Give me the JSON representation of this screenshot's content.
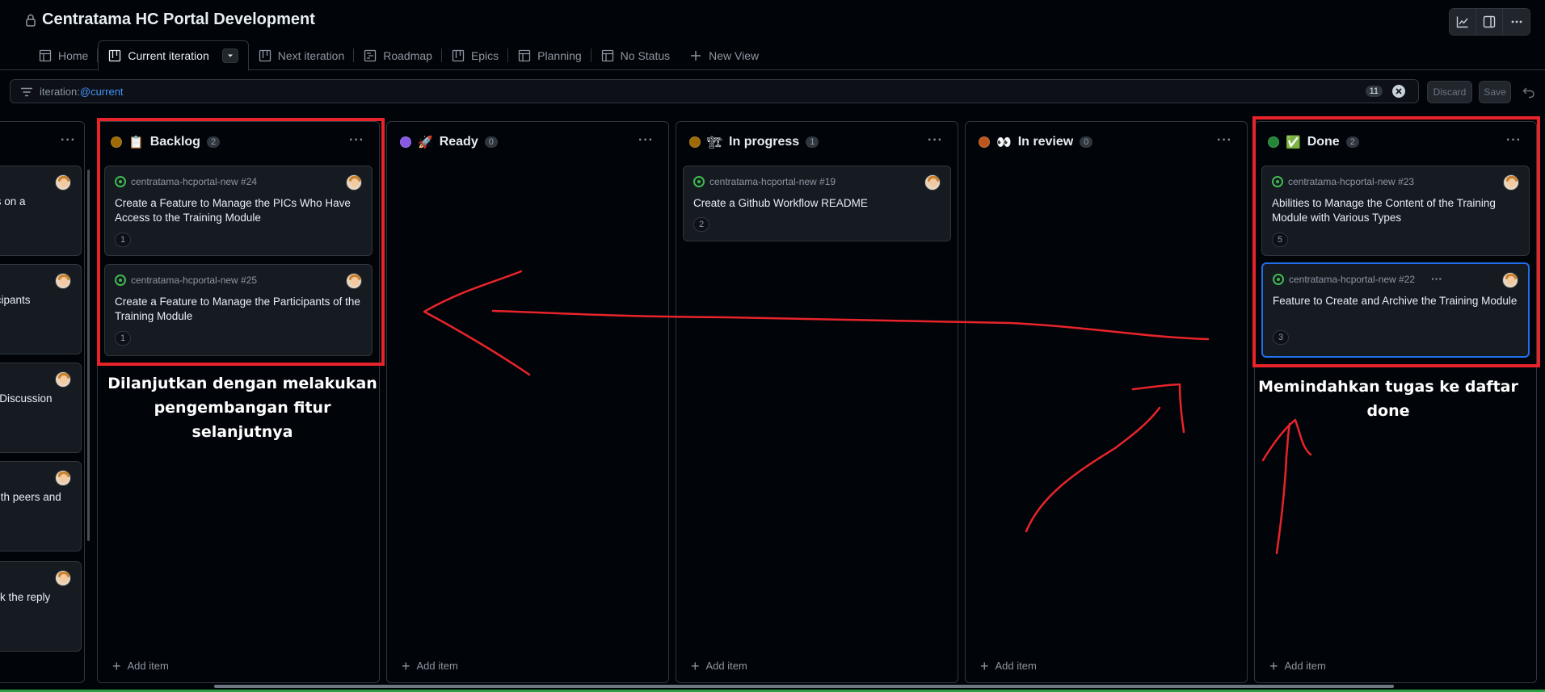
{
  "header": {
    "title": "Centratama HC Portal Development",
    "tabs": [
      {
        "label": "Home",
        "icon": "table-icon"
      },
      {
        "label": "Current iteration",
        "icon": "board-icon",
        "active": true
      },
      {
        "label": "Next iteration",
        "icon": "board-icon"
      },
      {
        "label": "Roadmap",
        "icon": "roadmap-icon"
      },
      {
        "label": "Epics",
        "icon": "board-icon"
      },
      {
        "label": "Planning",
        "icon": "table-icon"
      },
      {
        "label": "No Status",
        "icon": "table-icon"
      },
      {
        "label": "New View",
        "icon": "plus-icon"
      }
    ]
  },
  "filter": {
    "prefix": "iteration:",
    "value": "@current",
    "count": "11",
    "discard_label": "Discard",
    "save_label": "Save"
  },
  "partial_column": {
    "cards": [
      {
        "text": "ss on a"
      },
      {
        "text": "ticipants"
      },
      {
        "text": "n Discussion"
      },
      {
        "text": "with peers and"
      },
      {
        "text": "ark the reply"
      }
    ]
  },
  "columns": [
    {
      "name": "Backlog",
      "emoji": "📋",
      "count": "2",
      "dot_color": "#9e6a03",
      "add_label": "Add item",
      "cards": [
        {
          "repo": "centratama-hcportal-new #24",
          "title": "Create a Feature to Manage the PICs Who Have Access to the Training Module",
          "badge": "1"
        },
        {
          "repo": "centratama-hcportal-new #25",
          "title": "Create a Feature to Manage the Participants of the Training Module",
          "badge": "1"
        }
      ]
    },
    {
      "name": "Ready",
      "emoji": "🚀",
      "count": "0",
      "dot_color": "#8957e5",
      "add_label": "Add item",
      "cards": []
    },
    {
      "name": "In progress",
      "emoji": "🏗",
      "count": "1",
      "dot_color": "#9e6a03",
      "add_label": "Add item",
      "cards": [
        {
          "repo": "centratama-hcportal-new #19",
          "title": "Create a Github Workflow README",
          "badge": "2"
        }
      ]
    },
    {
      "name": "In review",
      "emoji": "👀",
      "count": "0",
      "dot_color": "#bd561d",
      "add_label": "Add item",
      "cards": []
    },
    {
      "name": "Done",
      "emoji": "✅",
      "count": "2",
      "dot_color": "#238636",
      "add_label": "Add item",
      "cards": [
        {
          "repo": "centratama-hcportal-new #23",
          "title": "Abilities to Manage the Content of the Training Module with Various Types",
          "badge": "5"
        },
        {
          "repo": "centratama-hcportal-new #22",
          "title": "Feature to Create and Archive the Training Module",
          "badge": "3",
          "more": "···"
        }
      ]
    }
  ],
  "annotations": {
    "left_note": "Dilanjutkan dengan melakukan pengembangan fitur selanjutnya",
    "right_note": "Memindahkan tugas ke daftar done",
    "stroke_color": "#e8242a"
  },
  "colors": {
    "background": "#010409",
    "card": "#161b22",
    "border": "#30363d",
    "accent_blue": "#4493f8",
    "issue_open": "#3fb950"
  }
}
